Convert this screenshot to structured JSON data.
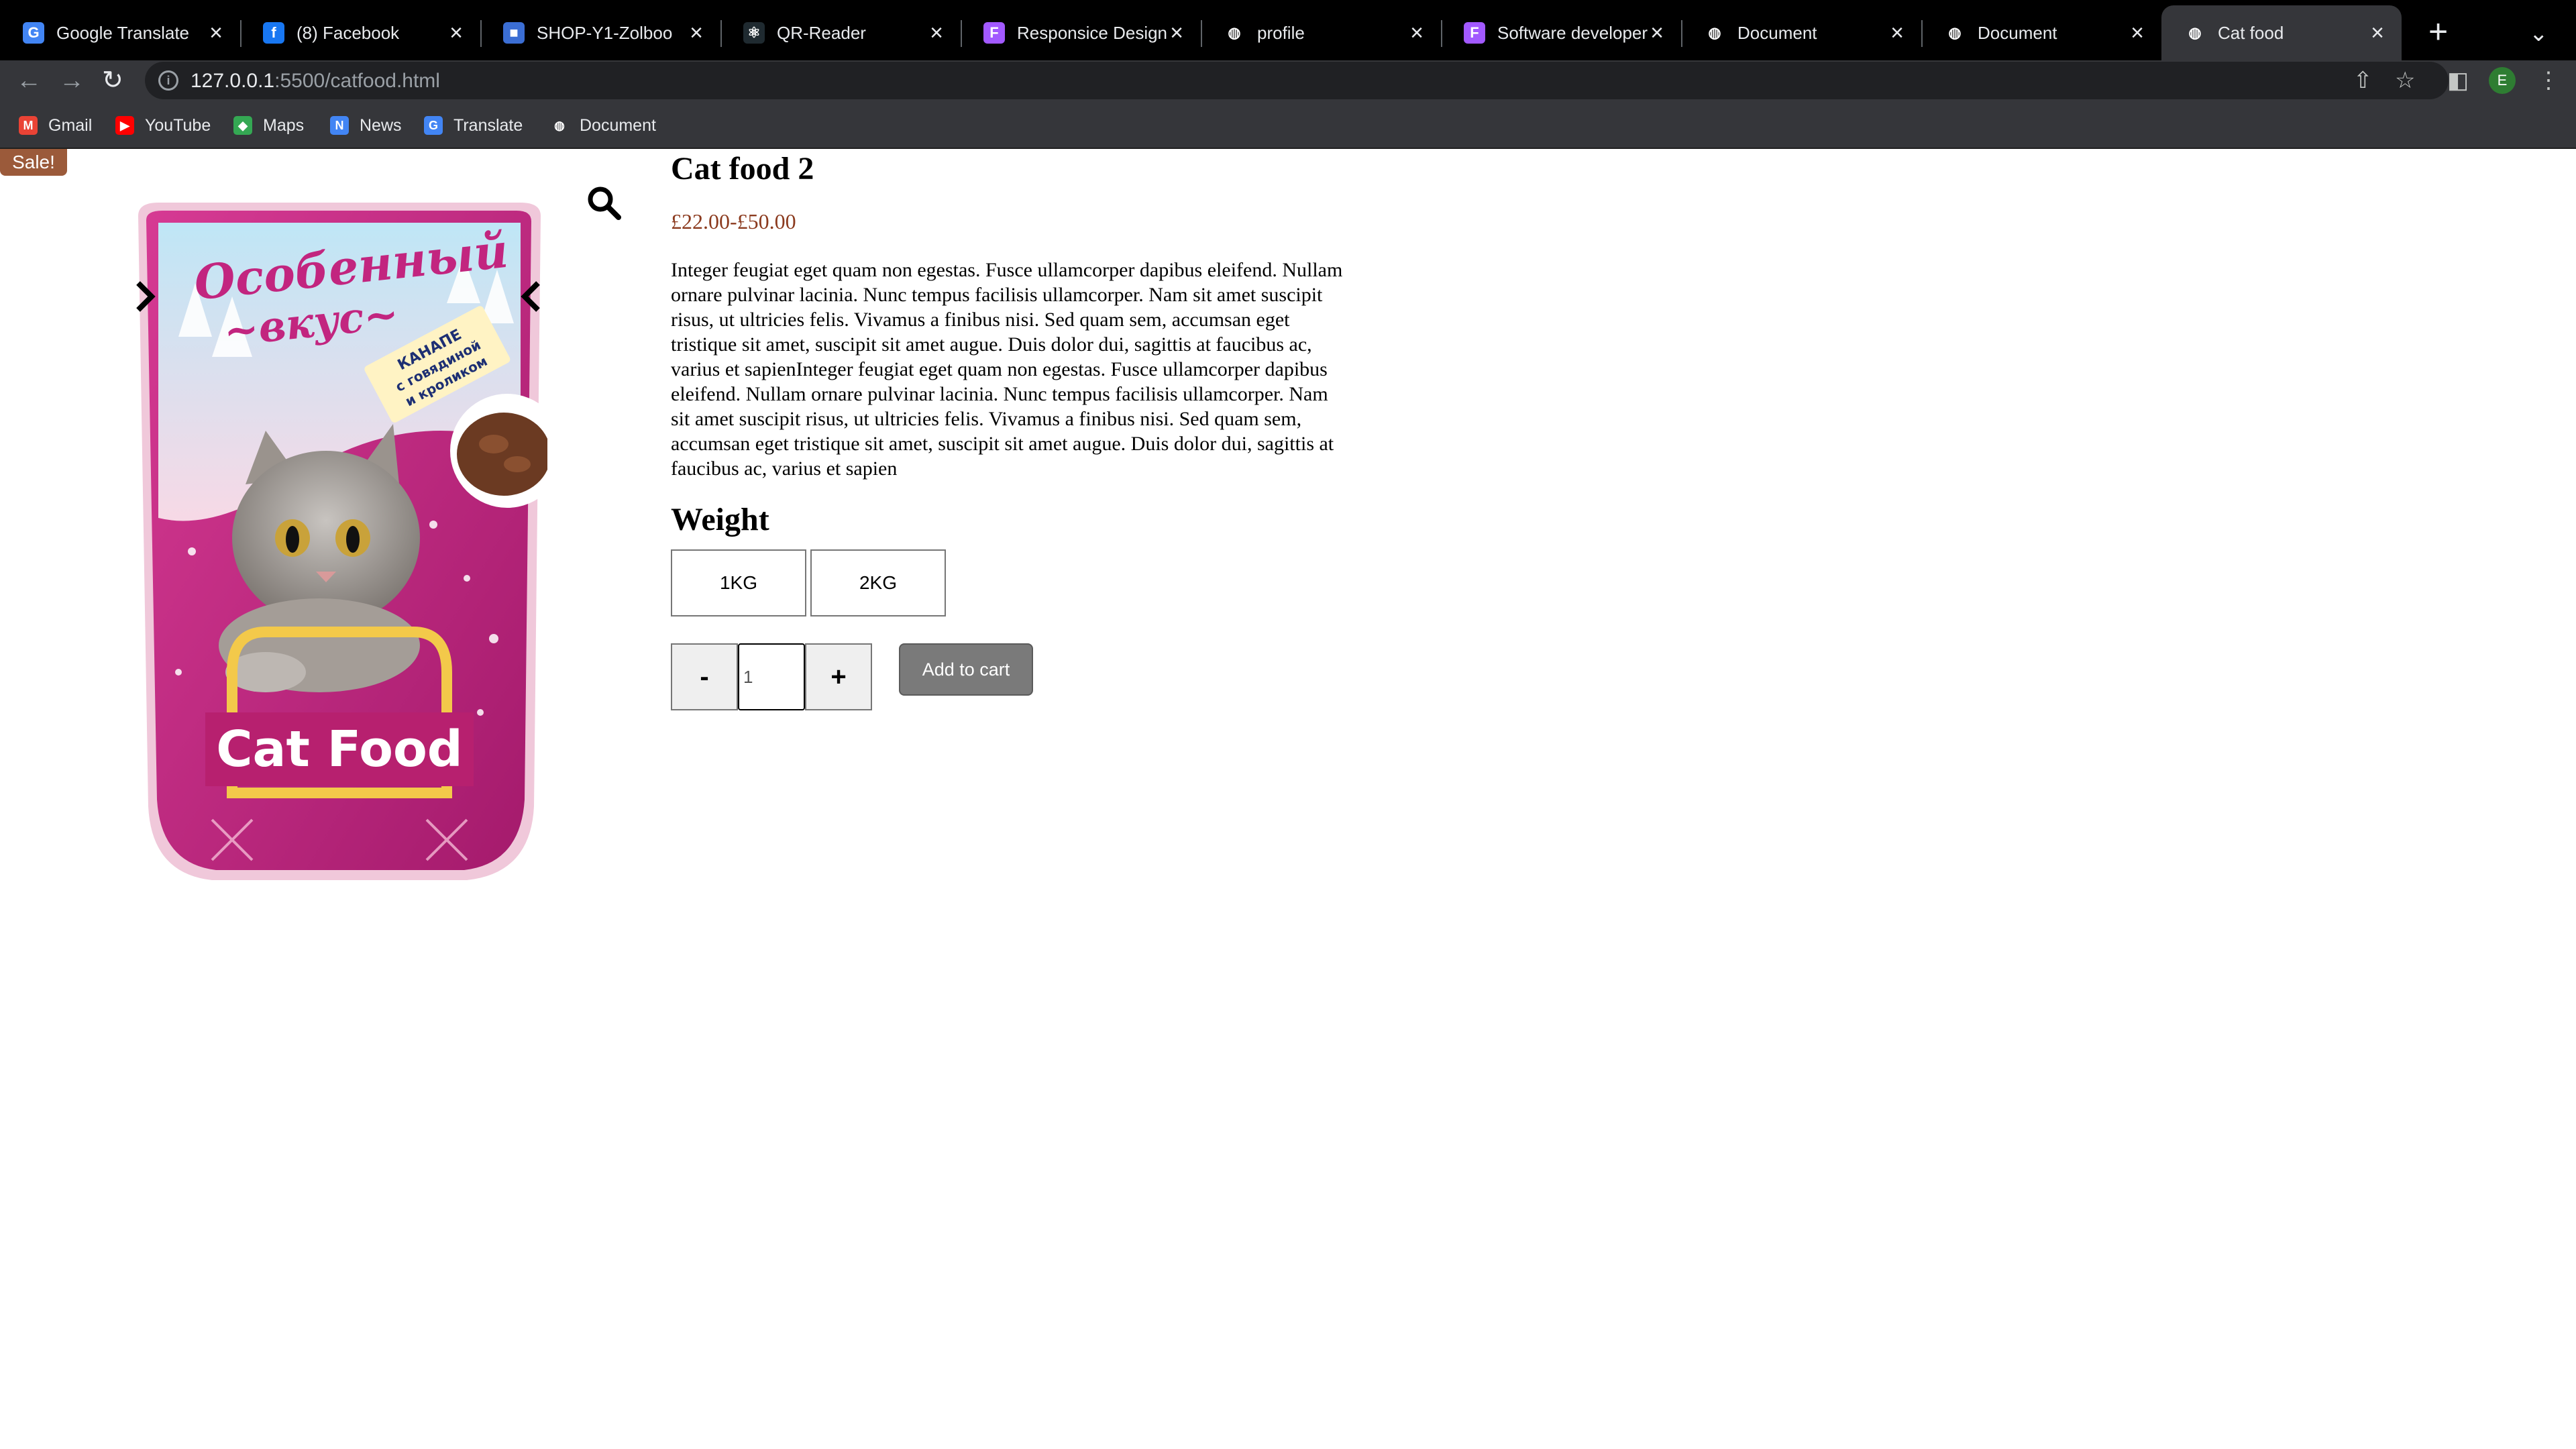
{
  "browser": {
    "tabs": [
      {
        "title": "Google Translate",
        "favicon": "translate-icon",
        "color": "#4285f4",
        "glyph": "G"
      },
      {
        "title": "(8) Facebook",
        "favicon": "facebook-icon",
        "color": "#1877f2",
        "glyph": "f"
      },
      {
        "title": "SHOP-Y1-Zolboo",
        "favicon": "classroom-icon",
        "color": "#3b6ed4",
        "glyph": "■"
      },
      {
        "title": "QR-Reader",
        "favicon": "react-icon",
        "color": "#1f2a30",
        "glyph": "⚛"
      },
      {
        "title": "Responsice Design",
        "favicon": "figma-icon",
        "color": "#a259ff",
        "glyph": "F"
      },
      {
        "title": "profile",
        "favicon": "globe-icon",
        "color": "#000000",
        "glyph": "◍"
      },
      {
        "title": "Software developer",
        "favicon": "figma-icon",
        "color": "#a259ff",
        "glyph": "F"
      },
      {
        "title": "Document",
        "favicon": "globe-icon",
        "color": "#000000",
        "glyph": "◍"
      },
      {
        "title": "Document",
        "favicon": "globe-icon",
        "color": "#000000",
        "glyph": "◍"
      },
      {
        "title": "Cat food",
        "favicon": "globe-icon",
        "color": "#35363a",
        "glyph": "◍",
        "active": true
      }
    ],
    "url_host": "127.0.0.1",
    "url_path": ":5500/catfood.html",
    "profile_initial": "E",
    "bookmarks": [
      {
        "label": "Gmail",
        "favicon": "gmail-icon",
        "color": "#ea4335",
        "glyph": "M"
      },
      {
        "label": "YouTube",
        "favicon": "youtube-icon",
        "color": "#ff0000",
        "glyph": "▶"
      },
      {
        "label": "Maps",
        "favicon": "maps-icon",
        "color": "#34a853",
        "glyph": "◆"
      },
      {
        "label": "News",
        "favicon": "news-icon",
        "color": "#4285f4",
        "glyph": "N"
      },
      {
        "label": "Translate",
        "favicon": "translate-icon",
        "color": "#4285f4",
        "glyph": "G"
      },
      {
        "label": "Document",
        "favicon": "globe-icon",
        "color": "#35363a",
        "glyph": "◍"
      }
    ]
  },
  "product": {
    "sale_badge": "Sale!",
    "title": "Cat food 2",
    "price": "£22.00-£50.00",
    "description": "Integer feugiat eget quam non egestas. Fusce ullamcorper dapibus eleifend. Nullam ornare pulvinar lacinia. Nunc tempus facilisis ullamcorper. Nam sit amet suscipit risus, ut ultricies felis. Vivamus a finibus nisi. Sed quam sem, accumsan eget tristique sit amet, suscipit sit amet augue. Duis dolor dui, sagittis at faucibus ac, varius et sapienInteger feugiat eget quam non egestas. Fusce ullamcorper dapibus eleifend. Nullam ornare pulvinar lacinia. Nunc tempus facilisis ullamcorper. Nam sit amet suscipit risus, ut ultricies felis. Vivamus a finibus nisi. Sed quam sem, accumsan eget tristique sit amet, suscipit sit amet augue. Duis dolor dui, sagittis at faucibus ac, varius et sapien",
    "weight_heading": "Weight",
    "weights": [
      "1KG",
      "2KG"
    ],
    "qty_minus": "-",
    "qty_plus": "+",
    "qty_value": "1",
    "add_to_cart": "Add to cart",
    "package": {
      "brand": "Особенный вкус",
      "flavor": "КАНАПЕ с говядиной и кроликом",
      "label": "Cat Food",
      "colors": {
        "primary": "#c2257f",
        "sky": "#9fd6ef",
        "dark": "#8e1a5f"
      }
    }
  }
}
